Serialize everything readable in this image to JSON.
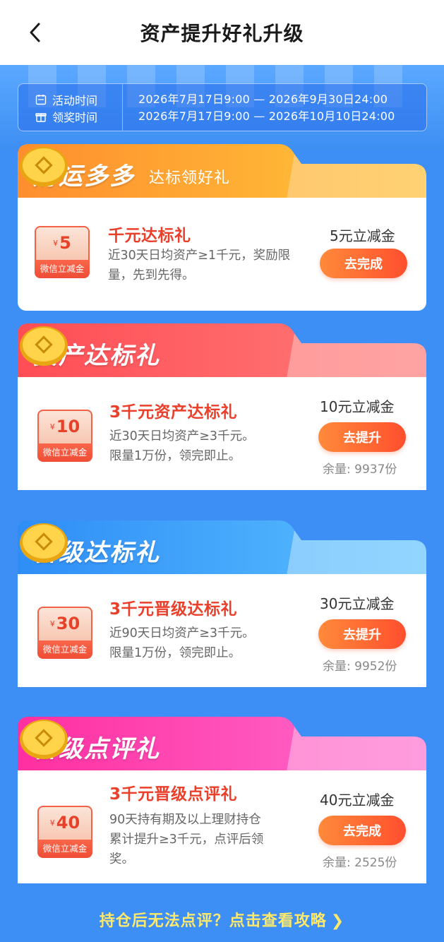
{
  "header": {
    "title": "资产提升好礼升级"
  },
  "activity": {
    "activity_time_label": "活动时间",
    "activity_time_value": "2026年7月17日9:00 — 2026年9月30日24:00",
    "claim_time_label": "领奖时间",
    "claim_time_value": "2026年7月17日9:00 — 2026年10月10日24:00"
  },
  "sections": [
    {
      "title": "财运多多",
      "subtitle": "达标领好礼",
      "coupon_amount": "5",
      "coupon_label": "微信立减金",
      "offer_title": "千元达标礼",
      "desc_line1": "近30天日均资产≥1千元，奖励限",
      "desc_line2": "量，先到先得。",
      "reward": "5元立减金",
      "button": "去完成",
      "stock": "",
      "colors": {
        "from": "#ff8e2e",
        "to": "#ffc93a"
      }
    },
    {
      "title": "资产达标礼",
      "coupon_amount": "10",
      "coupon_label": "微信立减金",
      "offer_title": "3千元资产达标礼",
      "desc_line1": "近30天日均资产≥3千元。",
      "desc_line2": "限量1万份，领完即止。",
      "reward": "10元立减金",
      "button": "去提升",
      "stock": "余量: 9937份",
      "colors": {
        "from": "#ff4d55",
        "to": "#ff7d7a"
      }
    },
    {
      "title": "晋级达标礼",
      "coupon_amount": "30",
      "coupon_label": "微信立减金",
      "offer_title": "3千元晋级达标礼",
      "desc_line1": "近90天日均资产≥3千元。",
      "desc_line2": "限量1万份，领完即止。",
      "reward": "30元立减金",
      "button": "去提升",
      "stock": "余量: 9952份",
      "colors": {
        "from": "#2f8df7",
        "to": "#5cc2ff"
      }
    },
    {
      "title": "晋级点评礼",
      "coupon_amount": "40",
      "coupon_label": "微信立减金",
      "offer_title": "3千元晋级点评礼",
      "desc_line1": "90天持有期及以上理财持仓",
      "desc_line2": "累计提升≥3千元，点评后领",
      "desc_line3": "奖。",
      "reward": "40元立减金",
      "button": "去完成",
      "stock": "余量: 2525份",
      "colors": {
        "from": "#ff2fa0",
        "to": "#ff6fd0"
      }
    }
  ],
  "footer": {
    "link": "持仓后无法点评？点击查看攻略"
  }
}
